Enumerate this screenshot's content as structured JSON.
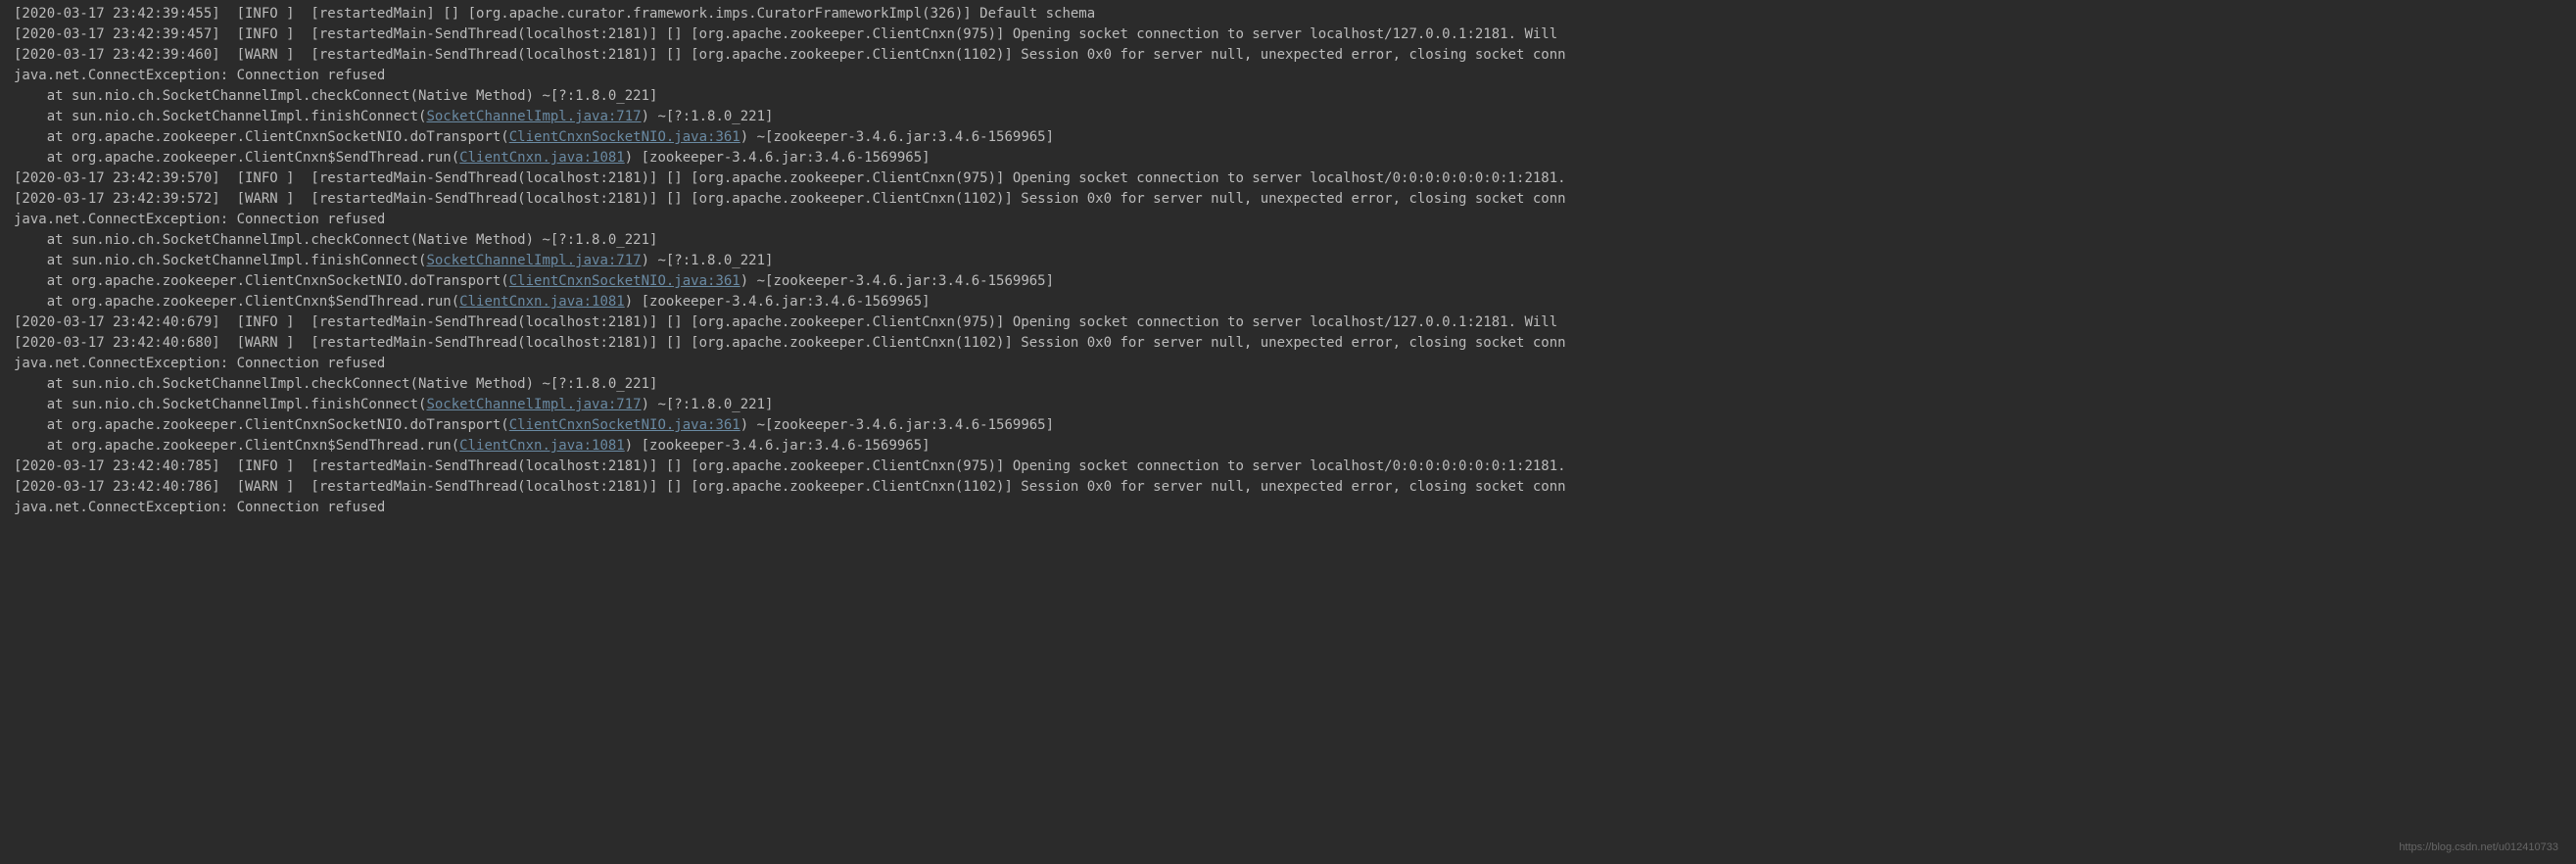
{
  "watermark": "https://blog.csdn.net/u012410733",
  "lines": [
    {
      "segs": [
        {
          "t": "[2020-03-17 23:42:39:455]  [INFO ]  [restartedMain] [] [org.apache.curator.framework.imps.CuratorFrameworkImpl(326)] Default schema"
        }
      ]
    },
    {
      "segs": [
        {
          "t": "[2020-03-17 23:42:39:457]  [INFO ]  [restartedMain-SendThread(localhost:2181)] [] [org.apache.zookeeper.ClientCnxn(975)] Opening socket connection to server localhost/127.0.0.1:2181. Will "
        }
      ]
    },
    {
      "segs": [
        {
          "t": "[2020-03-17 23:42:39:460]  [WARN ]  [restartedMain-SendThread(localhost:2181)] [] [org.apache.zookeeper.ClientCnxn(1102)] Session 0x0 for server null, unexpected error, closing socket conn"
        }
      ]
    },
    {
      "segs": [
        {
          "t": "java.net.ConnectException: Connection refused"
        }
      ]
    },
    {
      "segs": [
        {
          "t": "    at sun.nio.ch.SocketChannelImpl.checkConnect(Native Method) ~[?:1.8.0_221]"
        }
      ]
    },
    {
      "segs": [
        {
          "t": "    at sun.nio.ch.SocketChannelImpl.finishConnect("
        },
        {
          "t": "SocketChannelImpl.java:717",
          "link": true
        },
        {
          "t": ") ~[?:1.8.0_221]"
        }
      ]
    },
    {
      "segs": [
        {
          "t": "    at org.apache.zookeeper.ClientCnxnSocketNIO.doTransport("
        },
        {
          "t": "ClientCnxnSocketNIO.java:361",
          "link": true
        },
        {
          "t": ") ~[zookeeper-3.4.6.jar:3.4.6-1569965]"
        }
      ]
    },
    {
      "segs": [
        {
          "t": "    at org.apache.zookeeper.ClientCnxn$SendThread.run("
        },
        {
          "t": "ClientCnxn.java:1081",
          "link": true
        },
        {
          "t": ") [zookeeper-3.4.6.jar:3.4.6-1569965]"
        }
      ]
    },
    {
      "segs": [
        {
          "t": "[2020-03-17 23:42:39:570]  [INFO ]  [restartedMain-SendThread(localhost:2181)] [] [org.apache.zookeeper.ClientCnxn(975)] Opening socket connection to server localhost/0:0:0:0:0:0:0:1:2181."
        }
      ]
    },
    {
      "segs": [
        {
          "t": "[2020-03-17 23:42:39:572]  [WARN ]  [restartedMain-SendThread(localhost:2181)] [] [org.apache.zookeeper.ClientCnxn(1102)] Session 0x0 for server null, unexpected error, closing socket conn"
        }
      ]
    },
    {
      "segs": [
        {
          "t": "java.net.ConnectException: Connection refused"
        }
      ]
    },
    {
      "segs": [
        {
          "t": "    at sun.nio.ch.SocketChannelImpl.checkConnect(Native Method) ~[?:1.8.0_221]"
        }
      ]
    },
    {
      "segs": [
        {
          "t": "    at sun.nio.ch.SocketChannelImpl.finishConnect("
        },
        {
          "t": "SocketChannelImpl.java:717",
          "link": true
        },
        {
          "t": ") ~[?:1.8.0_221]"
        }
      ]
    },
    {
      "segs": [
        {
          "t": "    at org.apache.zookeeper.ClientCnxnSocketNIO.doTransport("
        },
        {
          "t": "ClientCnxnSocketNIO.java:361",
          "link": true
        },
        {
          "t": ") ~[zookeeper-3.4.6.jar:3.4.6-1569965]"
        }
      ]
    },
    {
      "segs": [
        {
          "t": "    at org.apache.zookeeper.ClientCnxn$SendThread.run("
        },
        {
          "t": "ClientCnxn.java:1081",
          "link": true
        },
        {
          "t": ") [zookeeper-3.4.6.jar:3.4.6-1569965]"
        }
      ]
    },
    {
      "segs": [
        {
          "t": "[2020-03-17 23:42:40:679]  [INFO ]  [restartedMain-SendThread(localhost:2181)] [] [org.apache.zookeeper.ClientCnxn(975)] Opening socket connection to server localhost/127.0.0.1:2181. Will "
        }
      ]
    },
    {
      "segs": [
        {
          "t": "[2020-03-17 23:42:40:680]  [WARN ]  [restartedMain-SendThread(localhost:2181)] [] [org.apache.zookeeper.ClientCnxn(1102)] Session 0x0 for server null, unexpected error, closing socket conn"
        }
      ]
    },
    {
      "segs": [
        {
          "t": "java.net.ConnectException: Connection refused"
        }
      ]
    },
    {
      "segs": [
        {
          "t": "    at sun.nio.ch.SocketChannelImpl.checkConnect(Native Method) ~[?:1.8.0_221]"
        }
      ]
    },
    {
      "segs": [
        {
          "t": "    at sun.nio.ch.SocketChannelImpl.finishConnect("
        },
        {
          "t": "SocketChannelImpl.java:717",
          "link": true
        },
        {
          "t": ") ~[?:1.8.0_221]"
        }
      ]
    },
    {
      "segs": [
        {
          "t": "    at org.apache.zookeeper.ClientCnxnSocketNIO.doTransport("
        },
        {
          "t": "ClientCnxnSocketNIO.java:361",
          "link": true
        },
        {
          "t": ") ~[zookeeper-3.4.6.jar:3.4.6-1569965]"
        }
      ]
    },
    {
      "segs": [
        {
          "t": "    at org.apache.zookeeper.ClientCnxn$SendThread.run("
        },
        {
          "t": "ClientCnxn.java:1081",
          "link": true
        },
        {
          "t": ") [zookeeper-3.4.6.jar:3.4.6-1569965]"
        }
      ]
    },
    {
      "segs": [
        {
          "t": "[2020-03-17 23:42:40:785]  [INFO ]  [restartedMain-SendThread(localhost:2181)] [] [org.apache.zookeeper.ClientCnxn(975)] Opening socket connection to server localhost/0:0:0:0:0:0:0:1:2181."
        }
      ]
    },
    {
      "segs": [
        {
          "t": "[2020-03-17 23:42:40:786]  [WARN ]  [restartedMain-SendThread(localhost:2181)] [] [org.apache.zookeeper.ClientCnxn(1102)] Session 0x0 for server null, unexpected error, closing socket conn"
        }
      ]
    },
    {
      "segs": [
        {
          "t": "java.net.ConnectException: Connection refused"
        }
      ]
    }
  ]
}
